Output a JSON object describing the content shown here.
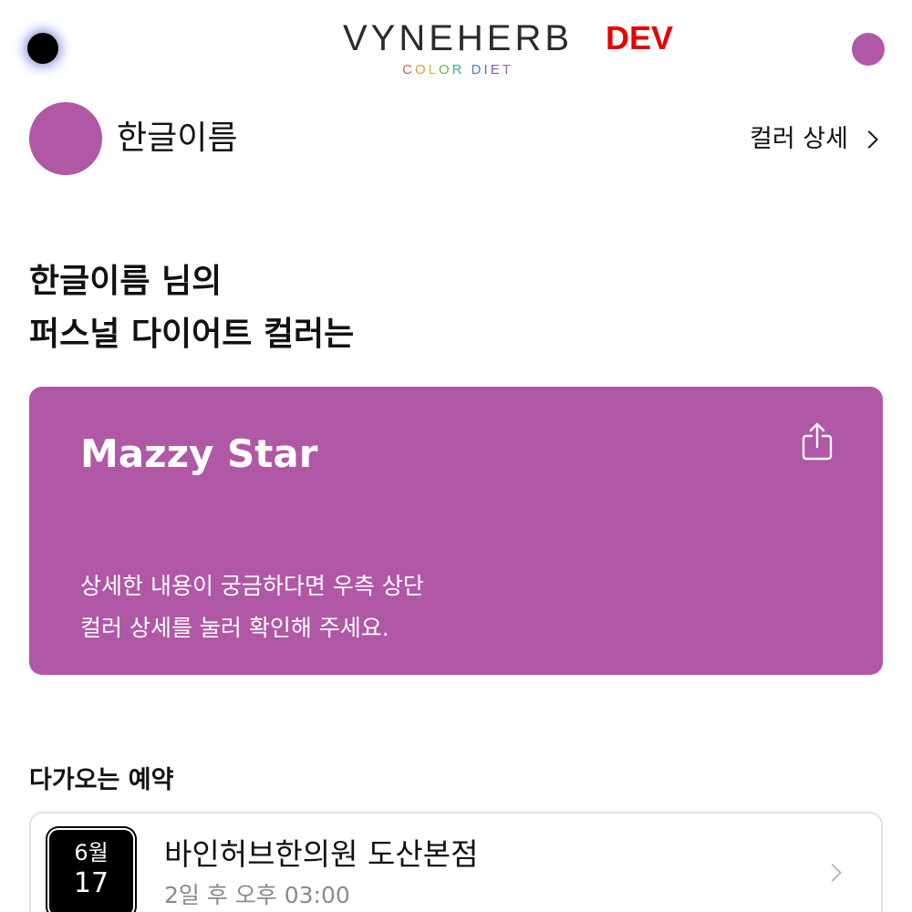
{
  "header": {
    "logo_main": "VYNEHERB",
    "logo_sub": [
      "C",
      "O",
      "L",
      "O",
      "R",
      " ",
      "D",
      "I",
      "E",
      "T"
    ],
    "logo_sub_colors": [
      "#e05a4f",
      "#e89a3a",
      "#d8b436",
      "#6db04d",
      "#3aa7a0",
      "#ffffff",
      "#4a7fc8",
      "#6a5fc0",
      "#8a57b5",
      "#a85aa8"
    ],
    "env_badge": "DEV",
    "profile_color": "#b058a6"
  },
  "user": {
    "name": "한글이름",
    "avatar_color": "#b058a6",
    "detail_link": "컬러 상세"
  },
  "headline": {
    "line1": "한글이름 님의",
    "line2": "퍼스널 다이어트 컬러는"
  },
  "color_card": {
    "bg_color": "#b058a6",
    "color_name": "Mazzy Star",
    "desc_line1": "상세한 내용이 궁금하다면 우측 상단",
    "desc_line2": "컬러 상세를 눌러 확인해 주세요."
  },
  "reservations": {
    "title": "다가오는 예약",
    "items": [
      {
        "month": "6월",
        "day": "17",
        "clinic": "바인허브한의원 도산본점",
        "time": "2일 후 오후 03:00"
      }
    ]
  }
}
